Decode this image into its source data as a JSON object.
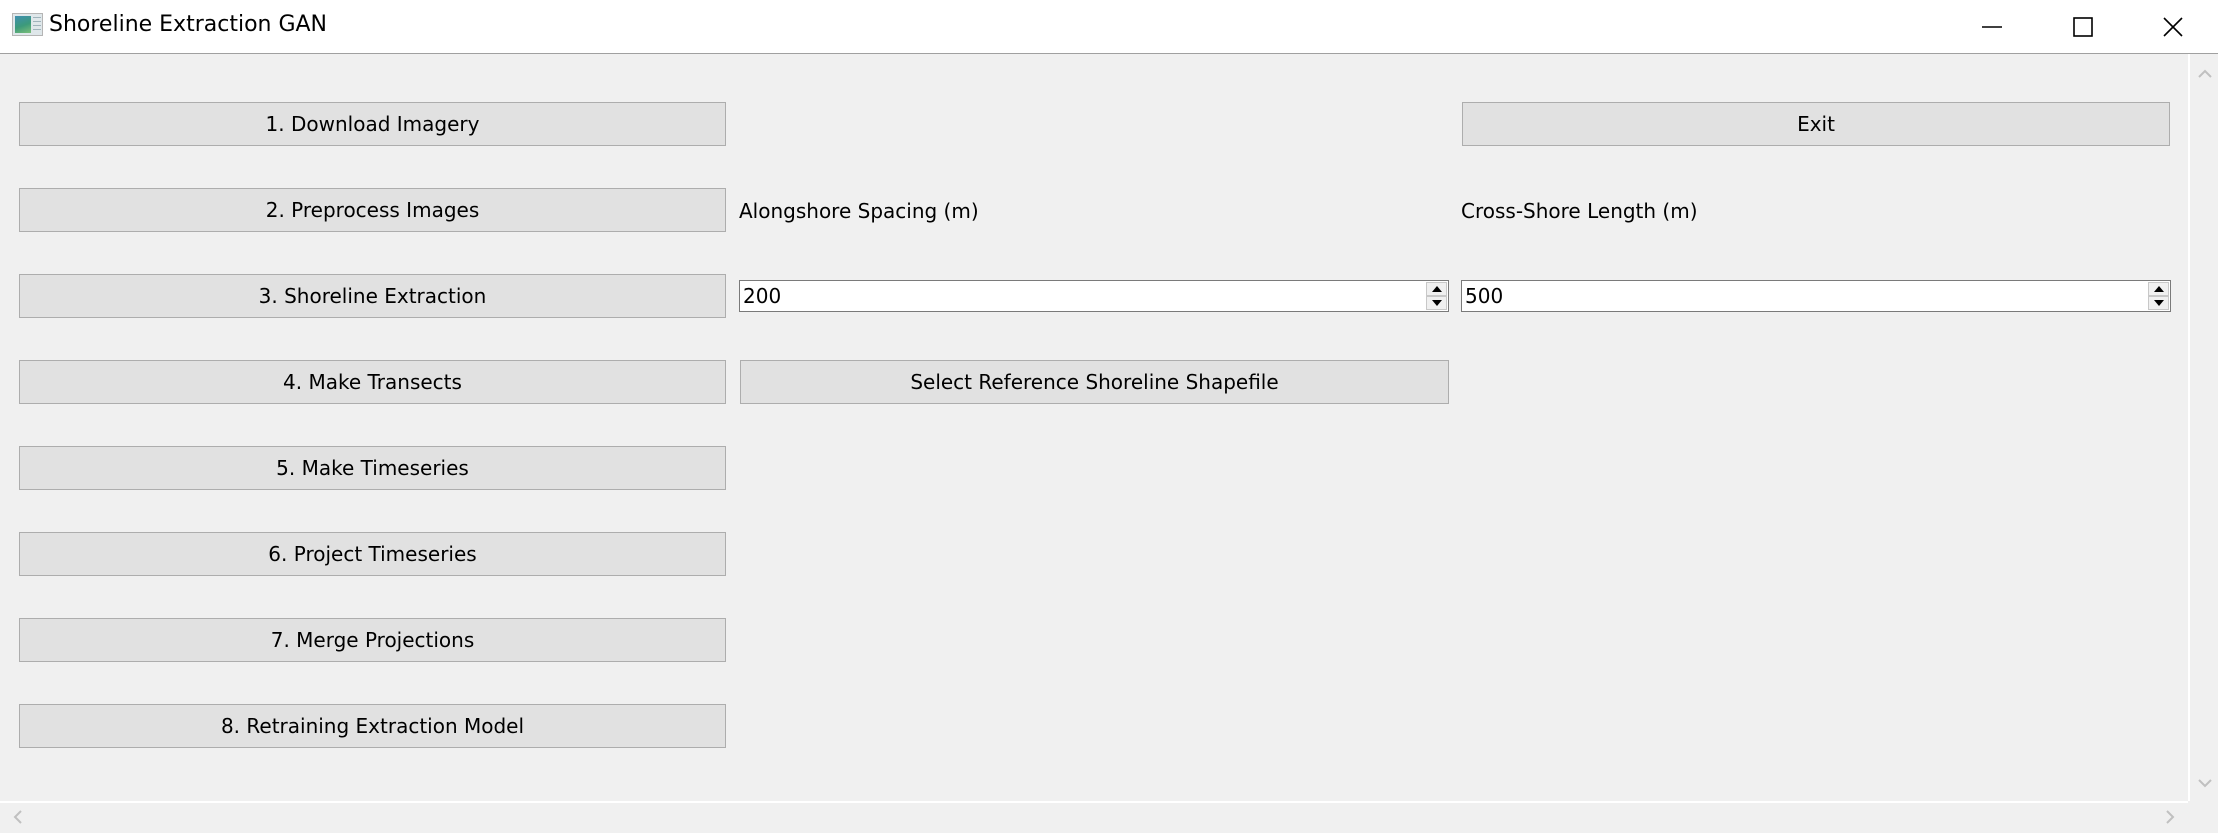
{
  "window": {
    "title": "Shoreline Extraction GAN",
    "icon": "app-window-icon",
    "controls": {
      "minimize": "minimize-icon",
      "maximize": "maximize-icon",
      "close": "close-icon"
    }
  },
  "workflow_buttons": [
    {
      "label": "1. Download Imagery"
    },
    {
      "label": "2. Preprocess Images"
    },
    {
      "label": "3. Shoreline Extraction"
    },
    {
      "label": "4. Make Transects"
    },
    {
      "label": "5. Make Timeseries"
    },
    {
      "label": "6. Project Timeseries"
    },
    {
      "label": "7. Merge Projections"
    },
    {
      "label": "8. Retraining Extraction Model"
    }
  ],
  "exit_button": {
    "label": "Exit"
  },
  "alongshore": {
    "label": "Alongshore Spacing (m)",
    "value": "200"
  },
  "crossshore": {
    "label": "Cross-Shore Length (m)",
    "value": "500"
  },
  "reference_button": {
    "label": "Select Reference Shoreline Shapefile"
  },
  "scrollbars": {
    "vertical": {
      "up": "chevron-up-icon",
      "down": "chevron-down-icon"
    },
    "horizontal": {
      "left": "chevron-left-icon",
      "right": "chevron-right-icon"
    }
  }
}
